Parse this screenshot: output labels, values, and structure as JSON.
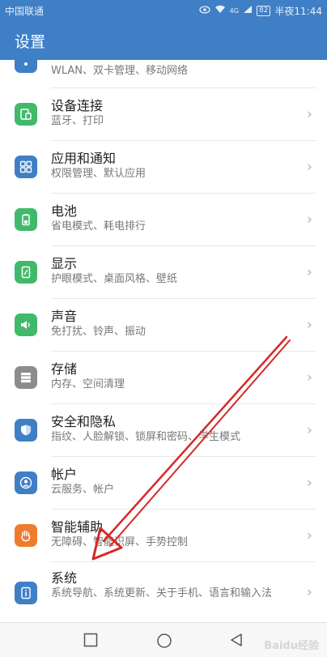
{
  "status": {
    "carrier": "中国联通",
    "battery": "82",
    "network": "4G",
    "time": "半夜11:44"
  },
  "app": {
    "title": "设置"
  },
  "items": [
    {
      "title": "",
      "sub": "WLAN、双卡管理、移动网络",
      "icon": "network-icon",
      "color": "#3f7fc6"
    },
    {
      "title": "设备连接",
      "sub": "蓝牙、打印",
      "icon": "device-connect-icon",
      "color": "#41b96a"
    },
    {
      "title": "应用和通知",
      "sub": "权限管理、默认应用",
      "icon": "apps-icon",
      "color": "#3f7fc6"
    },
    {
      "title": "电池",
      "sub": "省电模式、耗电排行",
      "icon": "battery-icon",
      "color": "#41b96a"
    },
    {
      "title": "显示",
      "sub": "护眼模式、桌面风格、壁纸",
      "icon": "display-icon",
      "color": "#41b96a"
    },
    {
      "title": "声音",
      "sub": "免打扰、铃声、振动",
      "icon": "sound-icon",
      "color": "#41b96a"
    },
    {
      "title": "存储",
      "sub": "内存、空间清理",
      "icon": "storage-icon",
      "color": "#8c8c8c"
    },
    {
      "title": "安全和隐私",
      "sub": "指纹、人脸解锁、锁屏和密码、学生模式",
      "icon": "shield-icon",
      "color": "#3f7fc6"
    },
    {
      "title": "帐户",
      "sub": "云服务、帐户",
      "icon": "account-icon",
      "color": "#3f7fc6"
    },
    {
      "title": "智能辅助",
      "sub": "无障碍、智能识屏、手势控制",
      "icon": "hand-icon",
      "color": "#ef7b2f"
    },
    {
      "title": "系统",
      "sub": "系统导航、系统更新、关于手机、语言和输入法",
      "icon": "info-icon",
      "color": "#3f7fc6"
    }
  ],
  "watermark": "Baidu经验"
}
